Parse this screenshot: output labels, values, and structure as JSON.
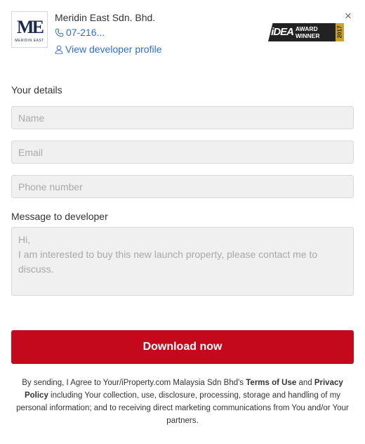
{
  "close_label": "×",
  "developer": {
    "logo_text": "ME",
    "logo_subtext": "MERIDIN EAST",
    "name": "Meridin East Sdn. Bhd.",
    "phone": "07-216...",
    "profile_link": "View developer profile"
  },
  "award": {
    "brand": "iDEA",
    "line1": "AWARD",
    "line2": "WINNER",
    "year": "2017"
  },
  "form": {
    "section_title": "Your details",
    "name_placeholder": "Name",
    "email_placeholder": "Email",
    "phone_placeholder": "Phone number",
    "message_label": "Message to developer",
    "message_placeholder": "Hi,\nI am interested to buy this new launch property, please contact me to discuss.",
    "submit_label": "Download now"
  },
  "legal": {
    "part1": "By sending, I Agree to Your/iProperty.com Malaysia Sdn Bhd's ",
    "terms_link": "Terms of Use",
    "part2": " and ",
    "privacy_link": "Privacy Policy",
    "part3": " including Your collection, use, disclosure, processing, storage and handling of my personal information; and to receiving direct marketing communications from You and/or Your partners."
  },
  "colors": {
    "primary_button": "#c4091c",
    "link": "#2f6fc9",
    "award_gold": "#c9a227"
  }
}
